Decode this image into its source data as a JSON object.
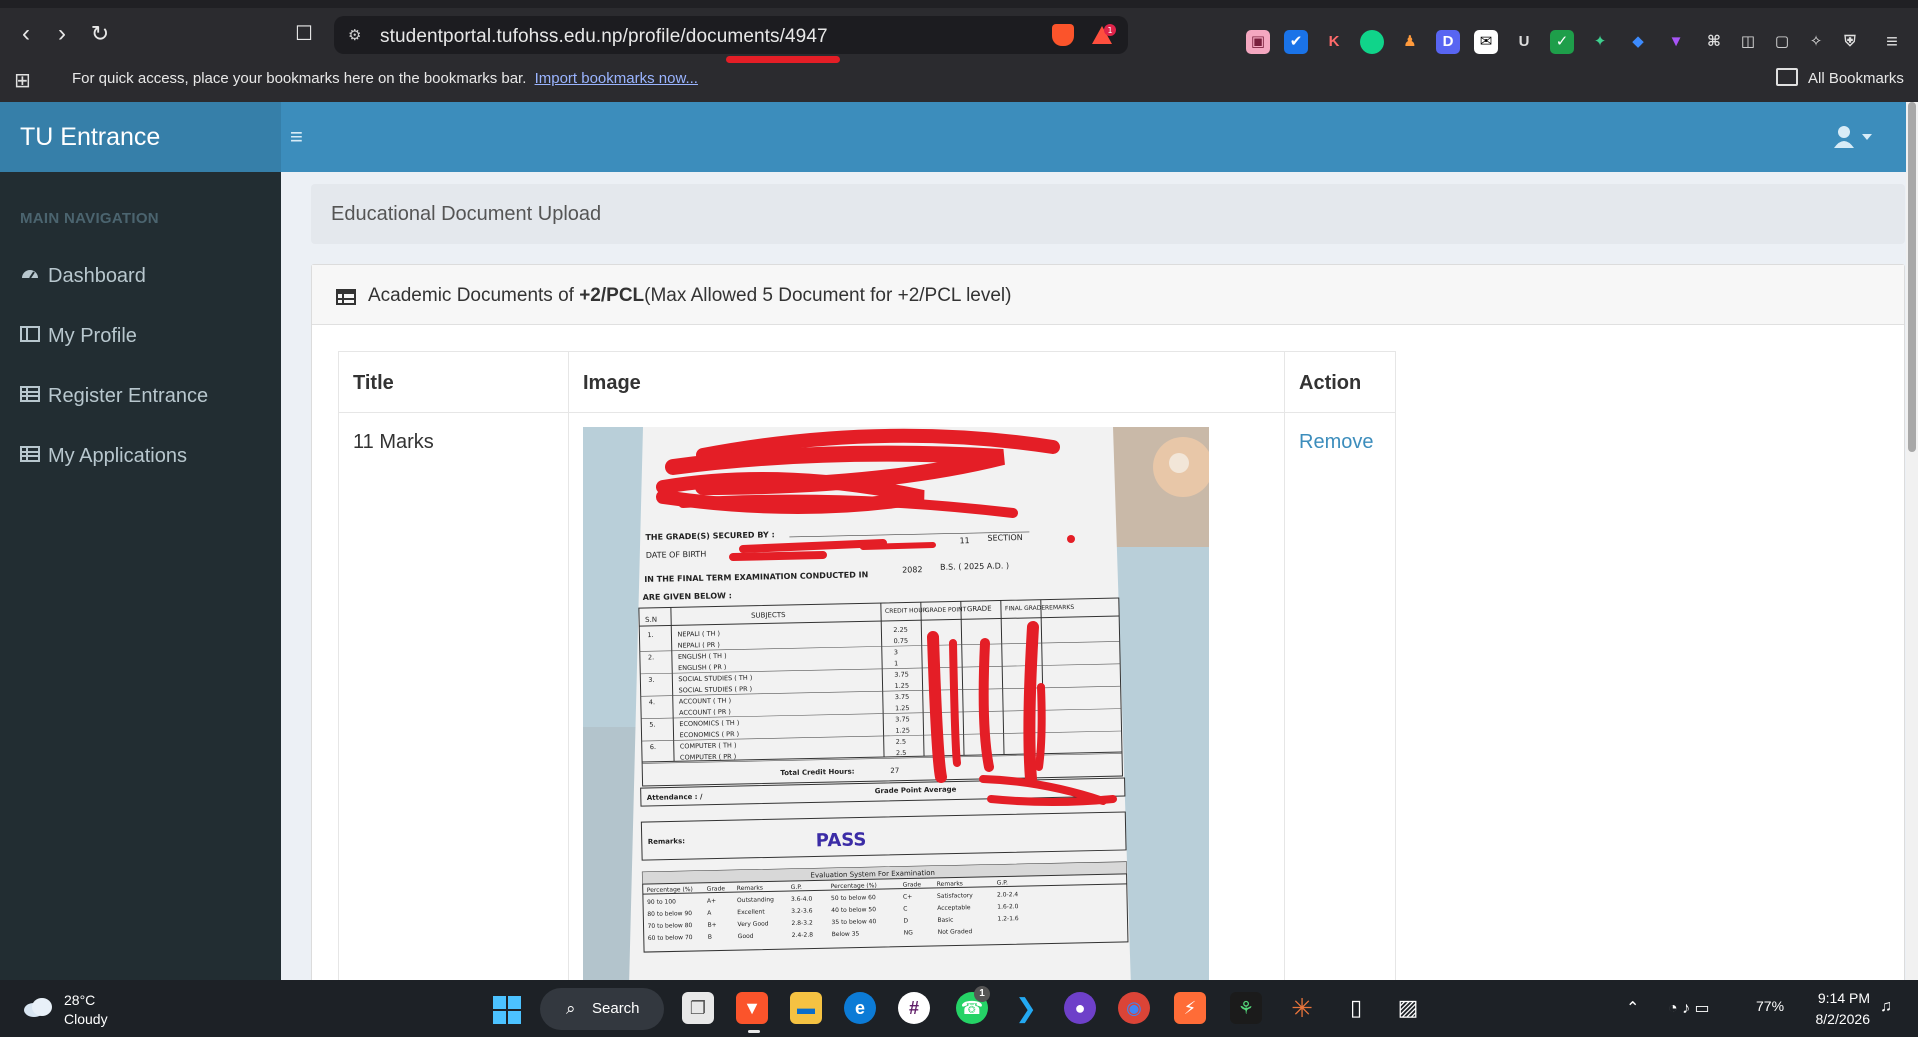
{
  "browser": {
    "url": "studentportal.tufohss.edu.np/profile/documents/4947",
    "bookmarks_message": "For quick access, place your bookmarks here on the bookmarks bar.",
    "bookmarks_link": "Import bookmarks now...",
    "all_bookmarks": "All Bookmarks",
    "rewards_badge": "1"
  },
  "app": {
    "brand": "TU Entrance",
    "nav_header": "MAIN NAVIGATION",
    "nav_items": [
      {
        "label": "Dashboard",
        "icon": "dashboard-icon"
      },
      {
        "label": "My Profile",
        "icon": "profile-icon"
      },
      {
        "label": "Register Entrance",
        "icon": "register-icon"
      },
      {
        "label": "My Applications",
        "icon": "applications-icon"
      }
    ]
  },
  "page": {
    "heading": "Educational Document Upload",
    "box_title_prefix": "Academic Documents of ",
    "box_title_level": "+2/PCL",
    "box_title_suffix": "(Max Allowed 5 Document for +2/PCL level)",
    "table": {
      "headers": [
        "Title",
        "Image",
        "Action"
      ],
      "rows": [
        {
          "title": "11 Marks",
          "action": "Remove"
        }
      ]
    }
  },
  "document_image": {
    "exam_line": "IN THE FINAL TERM EXAMINATION CONDUCTED IN",
    "year_bs": "2082",
    "year_ad": "B.S. ( 2025 A.D. )",
    "given_below": "ARE GIVEN BELOW :",
    "grades_secured_by": "THE GRADE(S) SECURED BY :",
    "date_of_birth": "DATE OF BIRTH",
    "section": "SECTION",
    "class": "11",
    "columns": [
      "S.N",
      "SUBJECTS",
      "CREDIT HOUR",
      "GRADE POINT",
      "GRADE",
      "FINAL GRADE",
      "REMARKS"
    ],
    "subjects": [
      {
        "sn": "1.",
        "name": "NEPALI ( TH )",
        "credit": "2.25"
      },
      {
        "sn": "",
        "name": "NEPALI ( PR )",
        "credit": "0.75"
      },
      {
        "sn": "2.",
        "name": "ENGLISH ( TH )",
        "credit": "3"
      },
      {
        "sn": "",
        "name": "ENGLISH ( PR )",
        "credit": "1"
      },
      {
        "sn": "3.",
        "name": "SOCIAL STUDIES ( TH )",
        "credit": "3.75"
      },
      {
        "sn": "",
        "name": "SOCIAL STUDIES ( PR )",
        "credit": "1.25"
      },
      {
        "sn": "4.",
        "name": "ACCOUNT ( TH )",
        "credit": "3.75"
      },
      {
        "sn": "",
        "name": "ACCOUNT ( PR )",
        "credit": "1.25"
      },
      {
        "sn": "5.",
        "name": "ECONOMICS ( TH )",
        "credit": "3.75"
      },
      {
        "sn": "",
        "name": "ECONOMICS ( PR )",
        "credit": "1.25"
      },
      {
        "sn": "6.",
        "name": "COMPUTER ( TH )",
        "credit": "2.5"
      },
      {
        "sn": "",
        "name": "COMPUTER ( PR )",
        "credit": "2.5"
      }
    ],
    "total_credit_label": "Total Credit Hours:",
    "total_credit": "27",
    "attendance": "Attendance : /",
    "gpa_label": "Grade Point Average",
    "remarks_label": "Remarks:",
    "result": "PASS",
    "eval_title": "Evaluation System For Examination",
    "eval_headers": [
      "Percentage (%)",
      "Grade",
      "Remarks",
      "G.P.",
      "Percentage (%)",
      "Grade",
      "Remarks",
      "G.P."
    ],
    "eval_rows": [
      [
        "90 to 100",
        "A+",
        "Outstanding",
        "3.6-4.0",
        "50 to below 60",
        "C+",
        "Satisfactory",
        "2.0-2.4"
      ],
      [
        "80 to below 90",
        "A",
        "Excellent",
        "3.2-3.6",
        "40 to below 50",
        "C",
        "Acceptable",
        "1.6-2.0"
      ],
      [
        "70 to below 80",
        "B+",
        "Very Good",
        "2.8-3.2",
        "35 to below 40",
        "D",
        "Basic",
        "1.2-1.6"
      ],
      [
        "60 to below 70",
        "B",
        "Good",
        "2.4-2.8",
        "Below 35",
        "NG",
        "Not Graded",
        ""
      ]
    ]
  },
  "taskbar": {
    "temperature": "28°C",
    "weather": "Cloudy",
    "search": "Search",
    "battery": "77%",
    "time": "9:14 PM",
    "date": "8/2/2026",
    "whatsapp_badge": "1"
  },
  "colors": {
    "header": "#3c8dbc",
    "logo_bg": "#367fa9",
    "sidebar": "#222d32",
    "link": "#3c8dbc",
    "redaction": "#e41e26"
  }
}
